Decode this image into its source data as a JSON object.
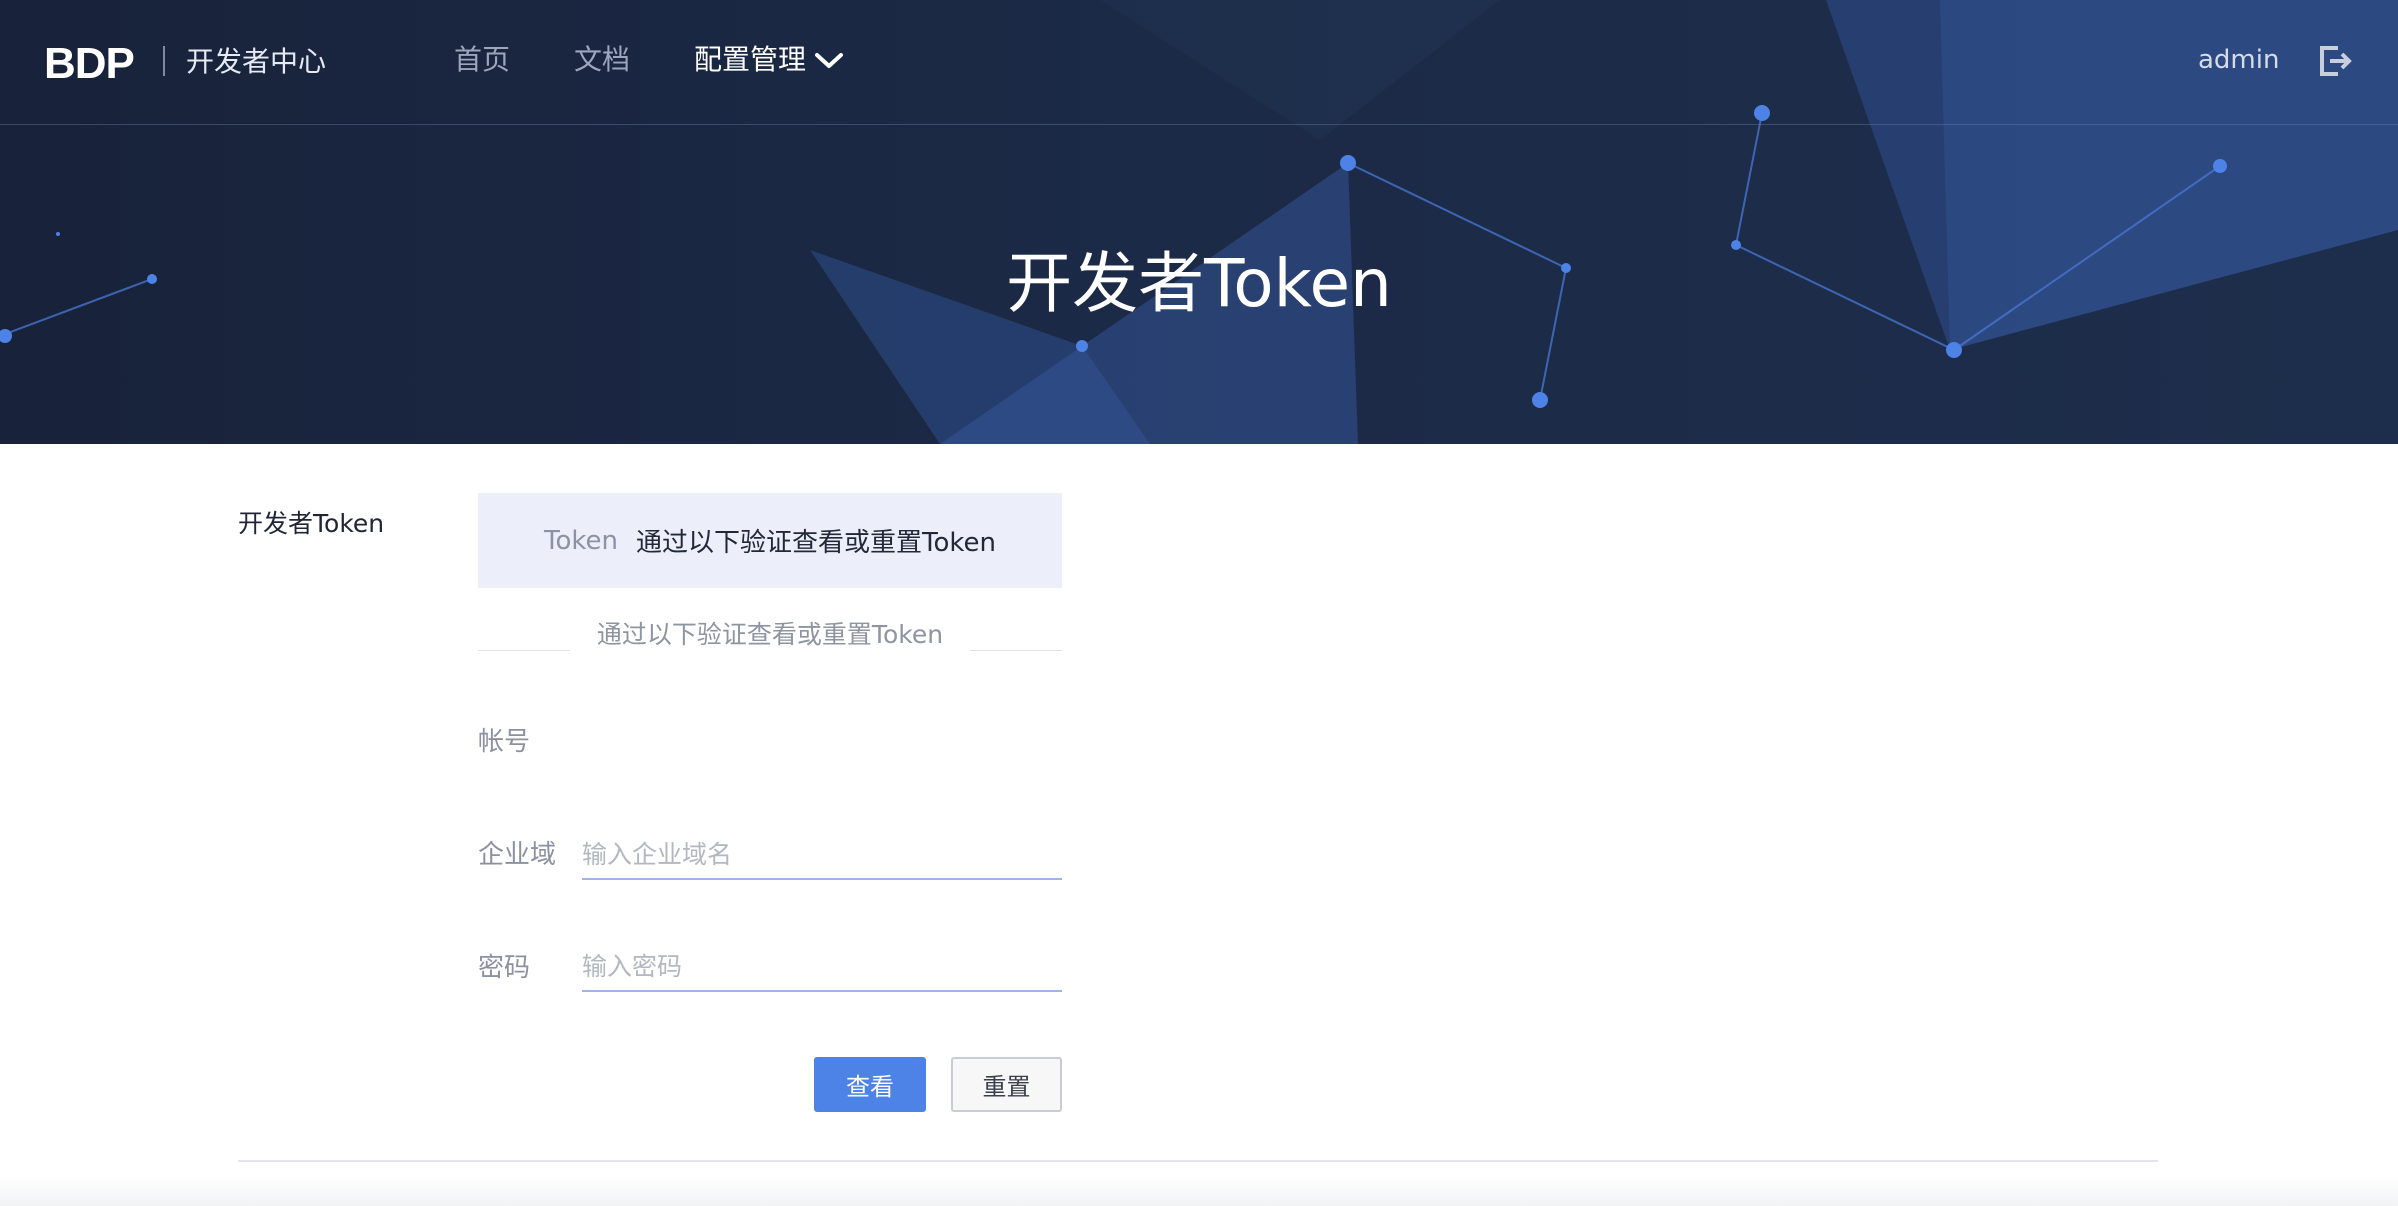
{
  "header": {
    "logo_text": "BDP",
    "subtitle": "开发者中心",
    "nav": [
      {
        "label": "首页"
      },
      {
        "label": "文档"
      },
      {
        "label": "配置管理"
      }
    ],
    "user": "admin",
    "icons": {
      "dropdown": "chevron-down-icon",
      "logout": "logout-icon"
    }
  },
  "hero": {
    "title": "开发者Token"
  },
  "main": {
    "section_label": "开发者Token",
    "token_box": {
      "key": "Token",
      "value": "通过以下验证查看或重置Token"
    },
    "divider_text": "通过以下验证查看或重置Token",
    "form": {
      "account_label": "帐号",
      "domain_label": "企业域",
      "domain_placeholder": "输入企业域名",
      "password_label": "密码",
      "password_placeholder": "输入密码"
    },
    "buttons": {
      "view": "查看",
      "reset": "重置"
    }
  },
  "colors": {
    "hero_bg": "#1b2945",
    "primary": "#4d82e6",
    "token_box_bg": "#eceff9"
  }
}
